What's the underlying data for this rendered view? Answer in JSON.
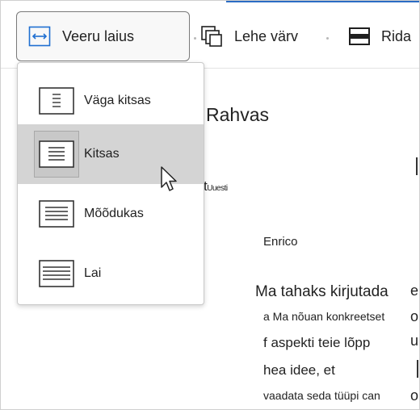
{
  "ribbon": {
    "column_width_label": "Veeru laius",
    "page_color_label": "Lehe värv",
    "lines_label": "Rida"
  },
  "menu": {
    "options": [
      {
        "label": "Väga kitsas",
        "selected": false
      },
      {
        "label": "Kitsas",
        "selected": true
      },
      {
        "label": "Mõõdukas",
        "selected": false
      },
      {
        "label": "Lai",
        "selected": false
      }
    ]
  },
  "document": {
    "title": "Rahvas",
    "meta_big": "t",
    "meta_small": "Uuesti",
    "author": "Enrico",
    "lines": [
      "Ma tahaks kirjutada",
      "a Ma nõuan konkreetset",
      "f aspekti teie lõpp",
      "hea idee, et",
      "vaadata seda tüüpi can"
    ],
    "right_edge_chars": [
      "e",
      "o",
      "u",
      "o"
    ]
  },
  "colors": {
    "accent": "#2b6cc4",
    "selected_bg": "#d4d4d4"
  }
}
